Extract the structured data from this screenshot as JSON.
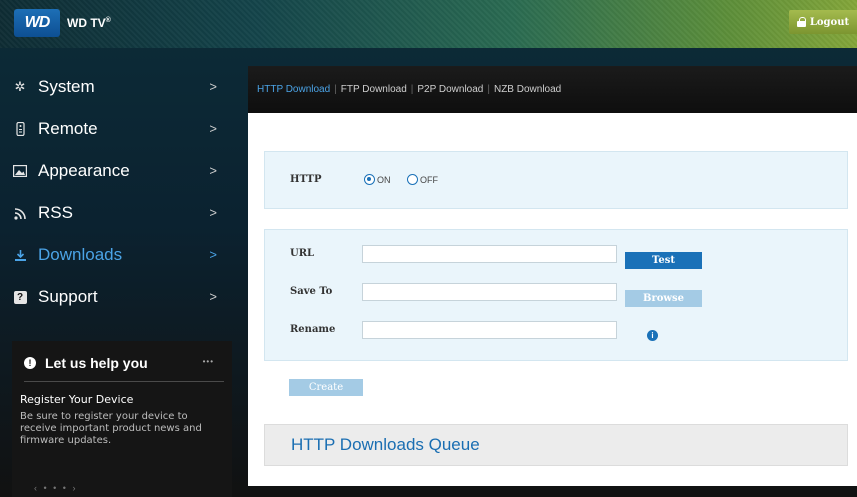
{
  "header": {
    "logo_text": "WD",
    "product": "WD TV",
    "product_mark": "®",
    "logout_label": "Logout"
  },
  "sidebar": {
    "items": [
      {
        "label": "System",
        "icon": "gear-icon"
      },
      {
        "label": "Remote",
        "icon": "remote-icon"
      },
      {
        "label": "Appearance",
        "icon": "image-icon"
      },
      {
        "label": "RSS",
        "icon": "rss-icon"
      },
      {
        "label": "Downloads",
        "icon": "download-icon",
        "active": true
      },
      {
        "label": "Support",
        "icon": "question-icon"
      }
    ],
    "chevron": ">",
    "help": {
      "title": "Let us help you",
      "more": "•••",
      "heading": "Register Your Device",
      "body": "Be sure to register your device to receive important product news and firmware updates.",
      "pager": "‹ • • • ›"
    }
  },
  "tabs": [
    {
      "label": "HTTP Download",
      "active": true
    },
    {
      "label": "FTP Download"
    },
    {
      "label": "P2P Download"
    },
    {
      "label": "NZB Download"
    }
  ],
  "tab_separator": "|",
  "http": {
    "label": "HTTP",
    "on_label": "ON",
    "off_label": "OFF",
    "selected": "ON"
  },
  "form": {
    "url_label": "URL",
    "url_value": "",
    "save_to_label": "Save To",
    "save_to_value": "",
    "rename_label": "Rename",
    "rename_value": "",
    "test_label": "Test",
    "browse_label": "Browse",
    "info_glyph": "i"
  },
  "create_label": "Create",
  "queue_title": "HTTP Downloads Queue",
  "colors": {
    "accent": "#1a71b8",
    "active_nav": "#4ba3e6",
    "disabled_button": "#a4cbe5",
    "logout": "#8aa33a"
  }
}
